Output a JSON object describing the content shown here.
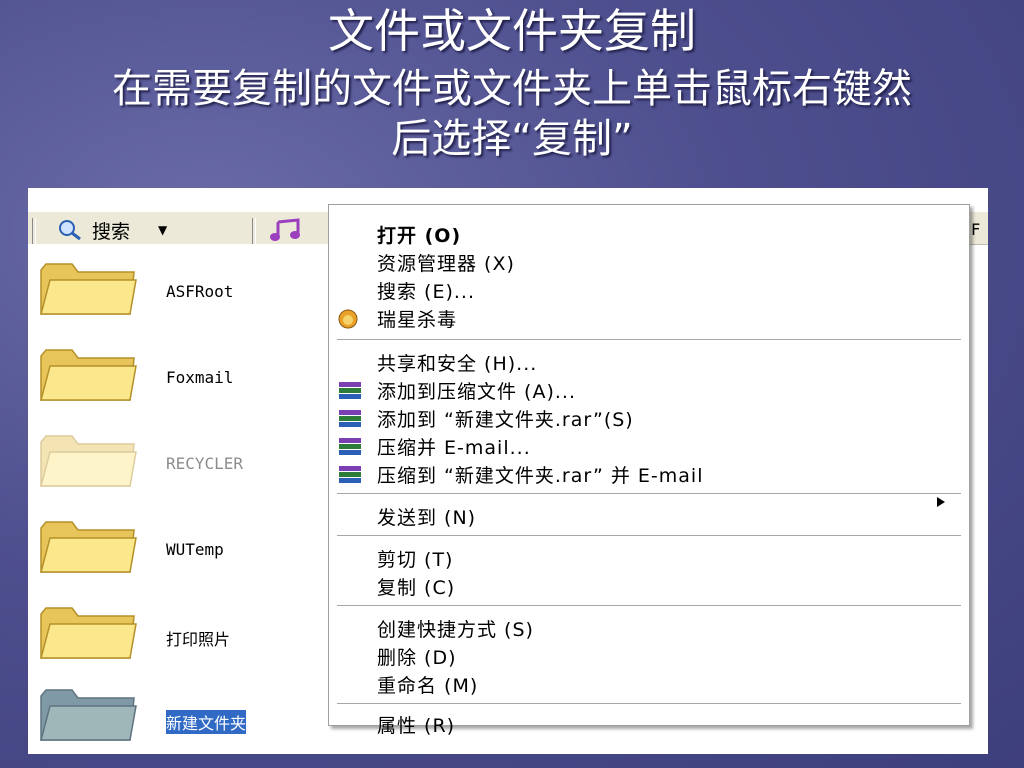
{
  "slide": {
    "title": "文件或文件夹复制",
    "subtitle_line1": "在需要复制的文件或文件夹上单击鼠标右键然",
    "subtitle_line2": "后选择“复制”"
  },
  "toolbar": {
    "search_label": "搜索",
    "right_fragment": ".F"
  },
  "files": [
    {
      "name": "ASFRoot"
    },
    {
      "name": "Foxmail"
    },
    {
      "name": "RECYCLER"
    },
    {
      "name": "WUTemp"
    },
    {
      "name": "打印照片"
    },
    {
      "name": "新建文件夹"
    }
  ],
  "context_menu": {
    "open": "打开 (O)",
    "explorer": "资源管理器 (X)",
    "search": "搜索 (E)...",
    "antivirus": "瑞星杀毒",
    "share": "共享和安全 (H)...",
    "add_archive": "添加到压缩文件 (A)...",
    "add_named_archive": "添加到 “新建文件夹.rar”(S)",
    "compress_email": "压缩并 E-mail...",
    "compress_named_email": "压缩到 “新建文件夹.rar” 并 E-mail",
    "send_to": "发送到 (N)",
    "cut": "剪切 (T)",
    "copy": "复制 (C)",
    "create_shortcut": "创建快捷方式 (S)",
    "delete": "删除 (D)",
    "rename": "重命名 (M)",
    "properties": "属性 (R)"
  },
  "colors": {
    "background": "#4e4f8e",
    "selection": "#316ac5",
    "folder": "#f5d96b"
  }
}
